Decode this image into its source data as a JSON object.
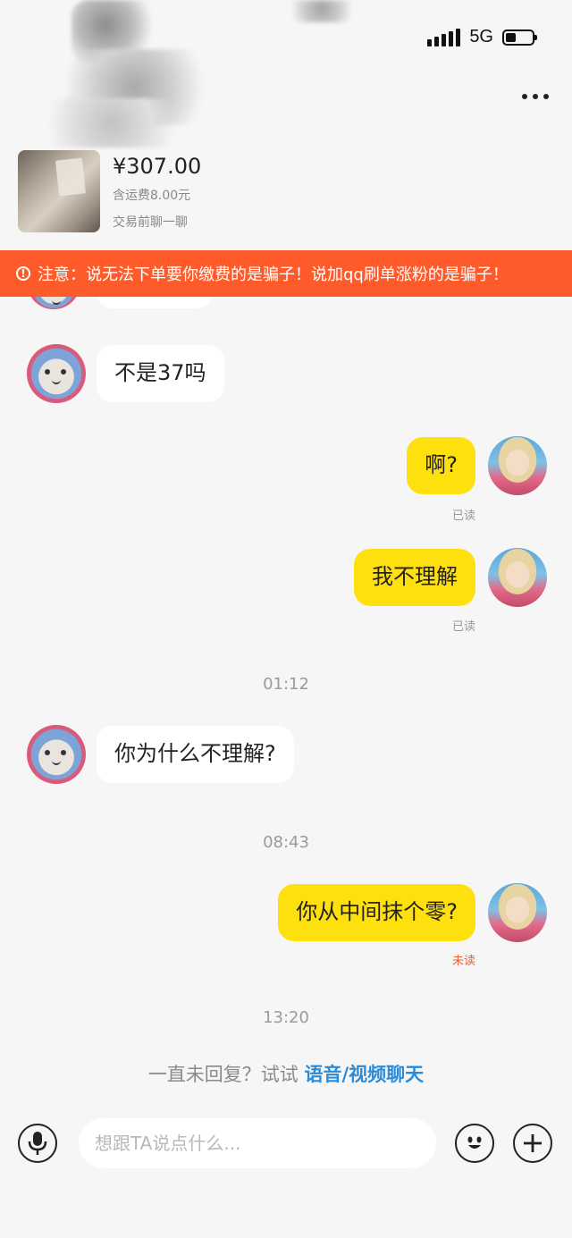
{
  "status_bar": {
    "network": "5G",
    "battery_level": 0.4
  },
  "header": {
    "more_label": "更多"
  },
  "product": {
    "price": "¥307.00",
    "shipping": "含运费8.00元",
    "hint": "交易前聊一聊"
  },
  "warning": {
    "icon": "!",
    "text": "注意：说无法下单要你缴费的是骗子！说加qq刷单涨粉的是骗子！"
  },
  "messages": [
    {
      "side": "in",
      "text": "不是37吗"
    },
    {
      "side": "out",
      "text": "啊?",
      "status": "已读"
    },
    {
      "side": "out",
      "text": "我不理解",
      "status": "已读"
    },
    {
      "side": "in",
      "text": "你为什么不理解?"
    },
    {
      "side": "out",
      "text": "你从中间抹个零?",
      "status": "未读"
    }
  ],
  "timestamps": [
    "01:12",
    "08:43",
    "13:20"
  ],
  "hint": {
    "prefix": "一直未回复？试试 ",
    "link": "语音/视频聊天"
  },
  "input": {
    "placeholder": "想跟TA说点什么..."
  },
  "colors": {
    "accent": "#ffe00f",
    "warning": "#ff5b2a",
    "link": "#2a8bd8",
    "unread": "#e8613a"
  }
}
